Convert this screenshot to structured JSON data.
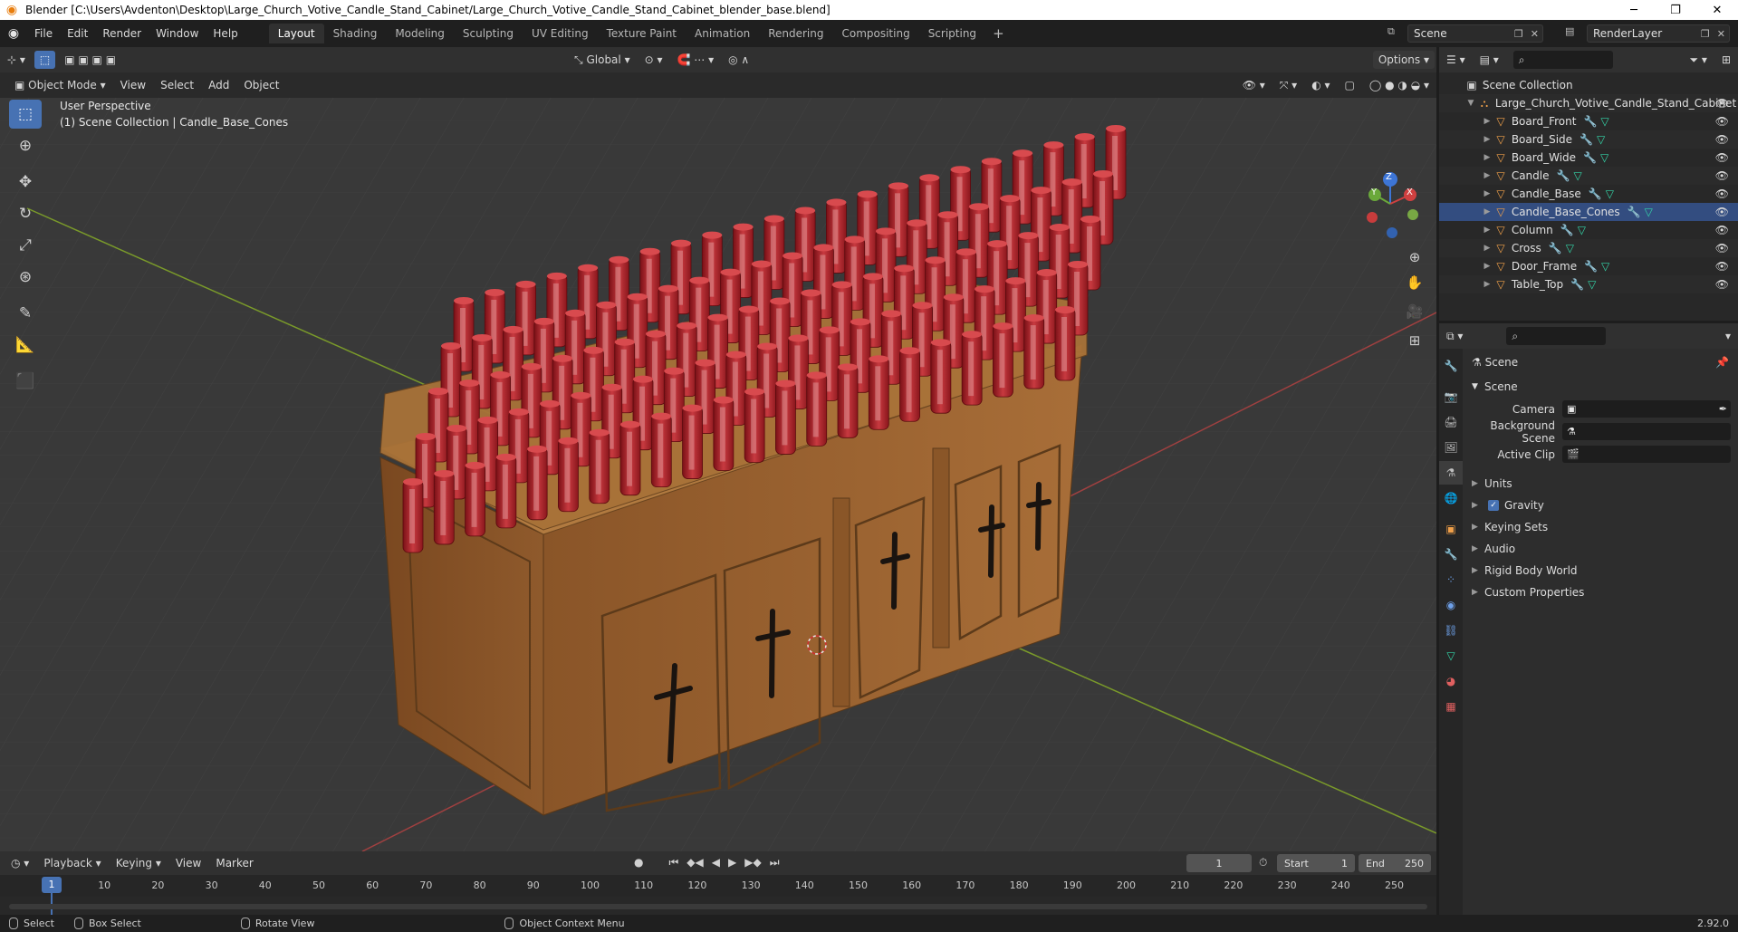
{
  "window": {
    "title": "Blender [C:\\Users\\Avdenton\\Desktop\\Large_Church_Votive_Candle_Stand_Cabinet/Large_Church_Votive_Candle_Stand_Cabinet_blender_base.blend]",
    "minimize": "─",
    "maximize": "❐",
    "close": "✕"
  },
  "menu": [
    "File",
    "Edit",
    "Render",
    "Window",
    "Help"
  ],
  "workspaces": [
    "Layout",
    "Shading",
    "Modeling",
    "Sculpting",
    "UV Editing",
    "Texture Paint",
    "Animation",
    "Rendering",
    "Compositing",
    "Scripting"
  ],
  "workspace_add": "+",
  "scene_name": "Scene",
  "view_layer": "RenderLayer",
  "viewport": {
    "mode": "Object Mode",
    "menus": [
      "View",
      "Select",
      "Add",
      "Object"
    ],
    "orientation": "Global",
    "options": "Options",
    "perspective": "User Perspective",
    "collection_info": "(1) Scene Collection | Candle_Base_Cones",
    "gizmo": {
      "z": "Z",
      "y": "Y",
      "x": "X"
    }
  },
  "outliner": {
    "root": "Scene Collection",
    "collection": "Large_Church_Votive_Candle_Stand_Cabinet",
    "items": [
      "Board_Front",
      "Board_Side",
      "Board_Wide",
      "Candle",
      "Candle_Base",
      "Candle_Base_Cones",
      "Column",
      "Cross",
      "Door_Frame",
      "Table_Top"
    ],
    "active_item": "Candle_Base_Cones"
  },
  "properties": {
    "context_title": "Scene",
    "panel_title": "Scene",
    "fields": [
      {
        "label": "Camera",
        "value": ""
      },
      {
        "label": "Background Scene",
        "value": ""
      },
      {
        "label": "Active Clip",
        "value": ""
      }
    ],
    "panels": [
      "Units",
      "Gravity",
      "Keying Sets",
      "Audio",
      "Rigid Body World",
      "Custom Properties"
    ],
    "gravity_checked": true
  },
  "timeline": {
    "menus": [
      "Playback",
      "Keying",
      "View",
      "Marker"
    ],
    "current_frame": "1",
    "start_label": "Start",
    "start": "1",
    "end_label": "End",
    "end": "250",
    "ticks": [
      "10",
      "20",
      "30",
      "40",
      "50",
      "60",
      "70",
      "80",
      "90",
      "100",
      "110",
      "120",
      "130",
      "140",
      "150",
      "160",
      "170",
      "180",
      "190",
      "200",
      "210",
      "220",
      "230",
      "240",
      "250"
    ],
    "playhead": "1"
  },
  "statusbar": {
    "items": [
      "Select",
      "Box Select",
      "Rotate View",
      "Object Context Menu"
    ],
    "version": "2.92.0"
  },
  "colors": {
    "accent": "#4772b3",
    "wood": "#a06a34",
    "candle": "#b3262b",
    "grid_x": "#8a3a3a",
    "grid_y": "#6a8a2a"
  }
}
